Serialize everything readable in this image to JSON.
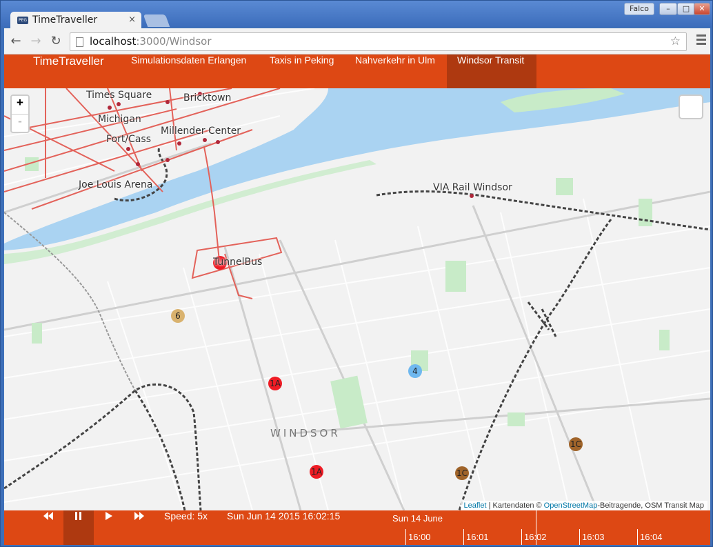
{
  "browser": {
    "tab_title": "TimeTraveller",
    "tab_close": "×",
    "favicon_text": "PEG",
    "profile": "Falco",
    "url_host": "localhost",
    "url_rest": ":3000/Windsor",
    "back": "←",
    "forward": "→",
    "reload": "↻",
    "star": "☆",
    "minimize": "–",
    "maximize": "□",
    "close": "✕"
  },
  "navbar": {
    "brand": "TimeTraveller",
    "links": [
      "Simulationsdaten Erlangen",
      "Taxis in Peking",
      "Nahverkehr in Ulm",
      "Windsor Transit"
    ],
    "active_index": 3
  },
  "map": {
    "zoom_in": "+",
    "zoom_out": "-",
    "labels": [
      "Times Square",
      "Bricktown",
      "Michigan",
      "Millender Center",
      "Fort/Cass",
      "Joe Louis Arena",
      "VIA Rail Windsor",
      "TunnelBus"
    ],
    "area_name": "WINDSOR",
    "vehicles": [
      {
        "label": "6",
        "color": "#d9b26e"
      },
      {
        "label": "4",
        "color": "#6fb8ef"
      },
      {
        "label": "1A",
        "color": "#ee1c25"
      },
      {
        "label": "1A",
        "color": "#ee1c25"
      },
      {
        "label": "1C",
        "color": "#a0642a"
      },
      {
        "label": "1C",
        "color": "#a0642a"
      },
      {
        "label": "",
        "color": "#ee1c25"
      }
    ],
    "attribution": {
      "leaflet": "Leaflet",
      "sep": " | Kartendaten © ",
      "osm": "OpenStreetMap",
      "rest": "-Beitragende, OSM Transit Map"
    }
  },
  "controls": {
    "rewind_icon": "rewind-icon",
    "pause_icon": "pause-icon",
    "play_icon": "play-icon",
    "fastforward_icon": "fast-forward-icon",
    "speed": "Speed: 5x",
    "current_time": "Sun Jun 14 2015 16:02:15",
    "day_label": "Sun 14 June",
    "ticks": [
      "16:00",
      "16:01",
      "16:02",
      "16:03",
      "16:04"
    ]
  },
  "colors": {
    "accent": "#dd4814",
    "accent_dark": "#ae3910",
    "water": "#aad3f2",
    "park": "#c8ebc8",
    "transit_line": "#e3625a"
  }
}
